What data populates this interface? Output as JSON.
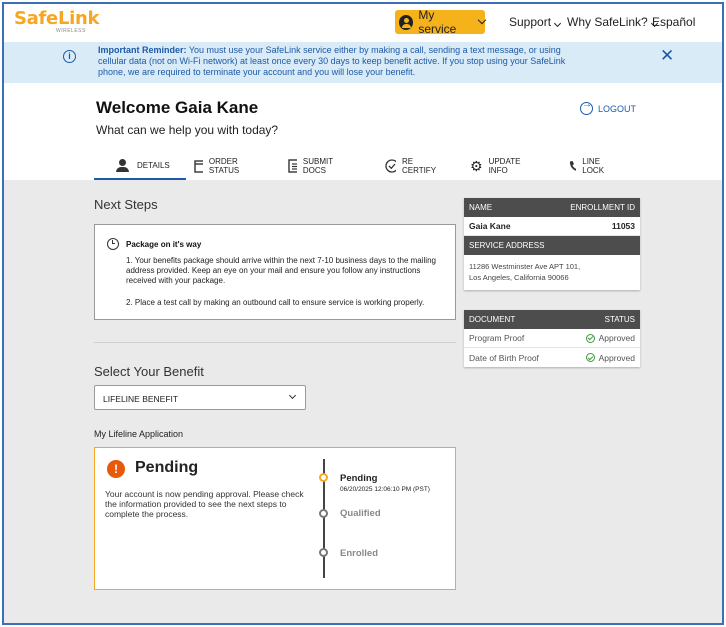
{
  "header": {
    "logo_text": "SafeLink",
    "logo_sub": "WIRELESS",
    "my_service_label": "My service",
    "nav": [
      "Support",
      "Why SafeLink?",
      "Español"
    ]
  },
  "banner": {
    "title": "Important Reminder:",
    "text": "You must use your SafeLink service either by making a call, sending a text message, or using cellular data (not on Wi-Fi network) at least once every 30 days to keep benefit active. If you stop using your SafeLink phone, we are required to terminate your account and you will lose your benefit."
  },
  "welcome": {
    "title": "Welcome Gaia Kane",
    "subtitle": "What can we help you with today?",
    "logout_label": "LOGOUT"
  },
  "tabs": [
    {
      "label": "DETAILS",
      "icon": "user-icon",
      "active": true
    },
    {
      "label": "ORDER STATUS",
      "icon": "browser-window-icon",
      "active": false
    },
    {
      "label": "SUBMIT DOCS",
      "icon": "document-icon",
      "active": false
    },
    {
      "label": "RE CERTIFY",
      "icon": "check-circle-icon",
      "active": false
    },
    {
      "label": "UPDATE INFO",
      "icon": "gear-icon",
      "active": false
    },
    {
      "label": "LINE LOCK",
      "icon": "phone-icon",
      "active": false
    }
  ],
  "next_steps": {
    "heading": "Next Steps",
    "package_title": "Package on it's way",
    "step1": "1. Your benefits package should arrive within the next 7-10 business days to the mailing address provided. Keep an eye on your mail and ensure you follow any instructions received with your package.",
    "step2": "2. Place a test call by making an outbound call to ensure service is working properly."
  },
  "benefit": {
    "heading": "Select Your Benefit",
    "selected": "LIFELINE BENEFIT"
  },
  "application": {
    "heading": "My Lifeline Application",
    "status_title": "Pending",
    "status_text": "Your account is now pending approval. Please check the information provided to see the next steps to complete the process.",
    "timeline": [
      {
        "label": "Pending",
        "date": "06/20/2025 12:06:10 PM (PST)",
        "active": true
      },
      {
        "label": "Qualified",
        "active": false
      },
      {
        "label": "Enrolled",
        "active": false
      }
    ]
  },
  "account": {
    "name_header": "NAME",
    "enrollment_header": "ENROLLMENT ID",
    "name": "Gaia Kane",
    "enrollment_id": "11053",
    "service_address_header": "SERVICE ADDRESS",
    "address_line1": "11286 Westminster Ave APT 101,",
    "address_line2": "Los Angeles, California 90066"
  },
  "documents": {
    "doc_header": "DOCUMENT",
    "status_header": "STATUS",
    "rows": [
      {
        "name": "Program Proof",
        "status": "Approved"
      },
      {
        "name": "Date of Birth Proof",
        "status": "Approved"
      }
    ]
  },
  "colors": {
    "brand_orange": "#f5a623",
    "link_blue": "#1e5aa8",
    "banner_bg": "#d9ebf7",
    "pending_icon": "#e8590c",
    "approved_green": "#3a9a3a"
  }
}
